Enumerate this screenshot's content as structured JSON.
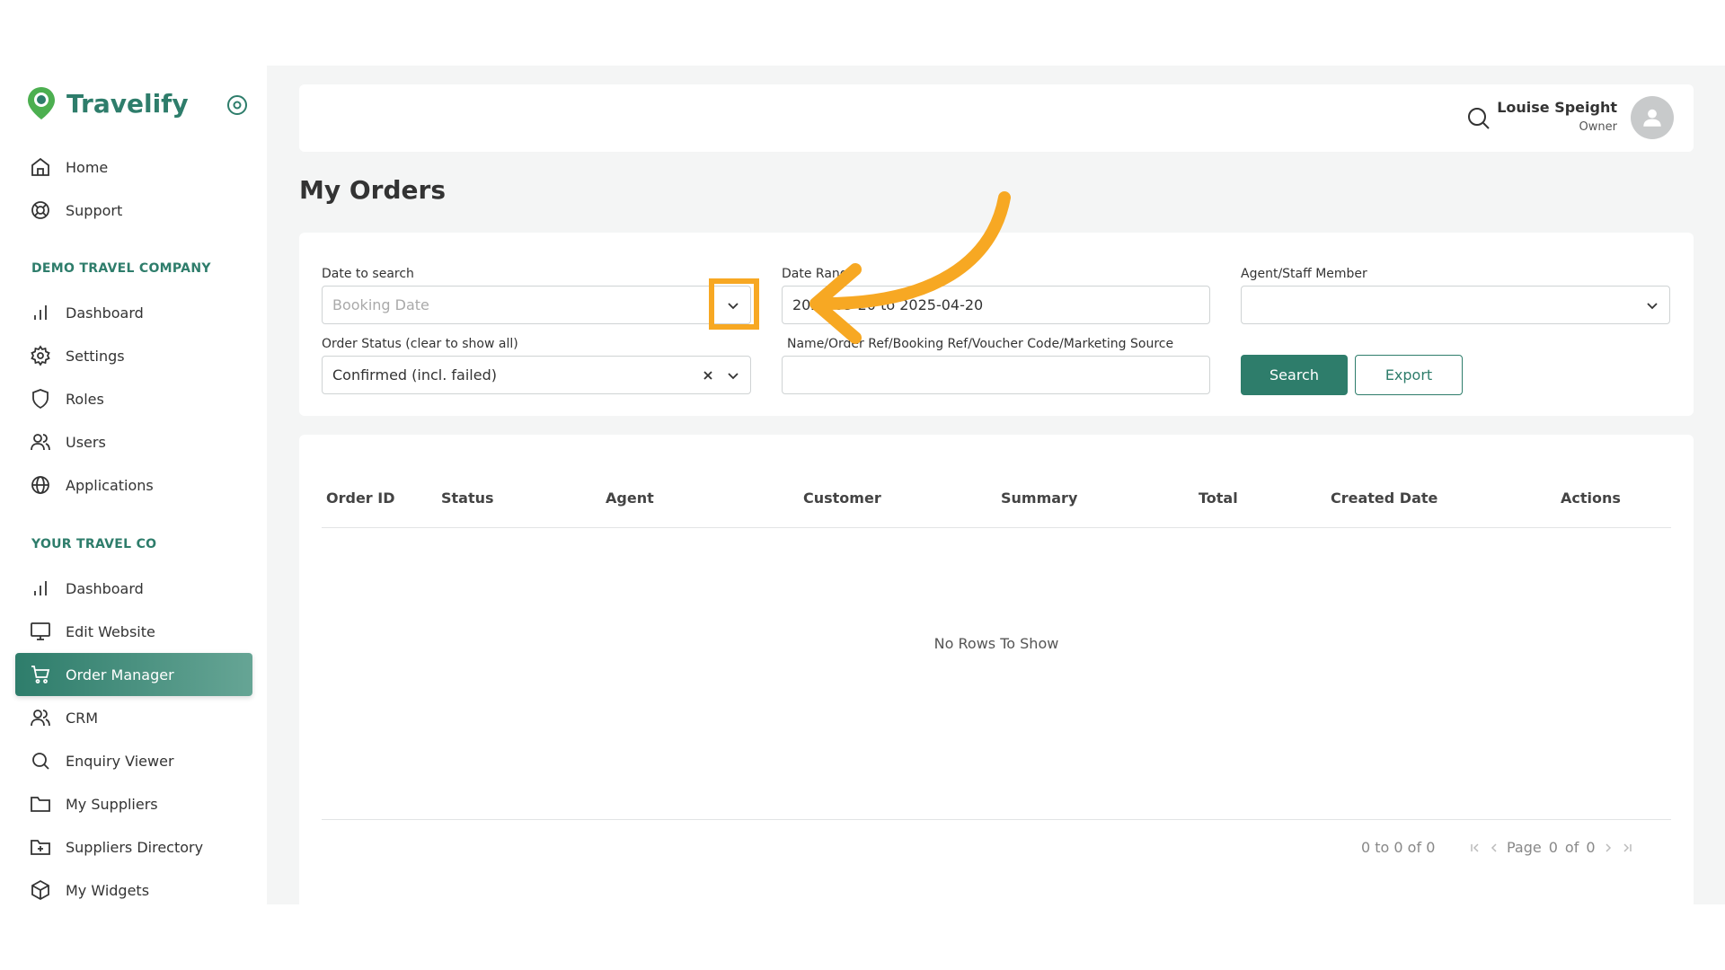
{
  "app": {
    "name": "Travelify"
  },
  "sidebar": {
    "top_items": [
      {
        "label": "Home",
        "icon": "home-icon"
      },
      {
        "label": "Support",
        "icon": "lifebuoy-icon"
      }
    ],
    "sections": [
      {
        "title": "DEMO TRAVEL COMPANY",
        "items": [
          {
            "label": "Dashboard",
            "icon": "bar-chart-icon"
          },
          {
            "label": "Settings",
            "icon": "gear-icon"
          },
          {
            "label": "Roles",
            "icon": "shield-icon"
          },
          {
            "label": "Users",
            "icon": "users-icon"
          },
          {
            "label": "Applications",
            "icon": "globe-icon"
          }
        ]
      },
      {
        "title": "YOUR TRAVEL CO",
        "items": [
          {
            "label": "Dashboard",
            "icon": "bar-chart-icon"
          },
          {
            "label": "Edit Website",
            "icon": "monitor-icon"
          },
          {
            "label": "Order Manager",
            "icon": "cart-icon",
            "active": true
          },
          {
            "label": "CRM",
            "icon": "users-icon"
          },
          {
            "label": "Enquiry Viewer",
            "icon": "search-icon"
          },
          {
            "label": "My Suppliers",
            "icon": "folder-icon"
          },
          {
            "label": "Suppliers Directory",
            "icon": "folder-plus-icon"
          },
          {
            "label": "My Widgets",
            "icon": "cube-icon"
          }
        ]
      }
    ]
  },
  "header": {
    "user_name": "Louise Speight",
    "user_role": "Owner"
  },
  "page": {
    "title": "My Orders"
  },
  "filters": {
    "date_to_search_label": "Date to search",
    "date_to_search_placeholder": "Booking Date",
    "date_range_label": "Date Range",
    "date_range_value": "2025-03-20 to 2025-04-20",
    "agent_label": "Agent/Staff Member",
    "order_status_label": "Order Status (clear to show all)",
    "order_status_value": "Confirmed (incl. failed)",
    "name_ref_label": "Name/Order Ref/Booking Ref/Voucher Code/Marketing Source",
    "search_button": "Search",
    "export_button": "Export"
  },
  "table": {
    "columns": [
      "Order ID",
      "Status",
      "Agent",
      "Customer",
      "Summary",
      "Total",
      "Created Date",
      "Actions"
    ],
    "empty_message": "No Rows To Show",
    "pagination": {
      "range_text": "0 to 0 of 0",
      "page_label": "Page",
      "page_current": "0",
      "of_label": "of",
      "page_total": "0"
    }
  },
  "colors": {
    "brand": "#2e7d6b",
    "annotation": "#f7a823"
  }
}
